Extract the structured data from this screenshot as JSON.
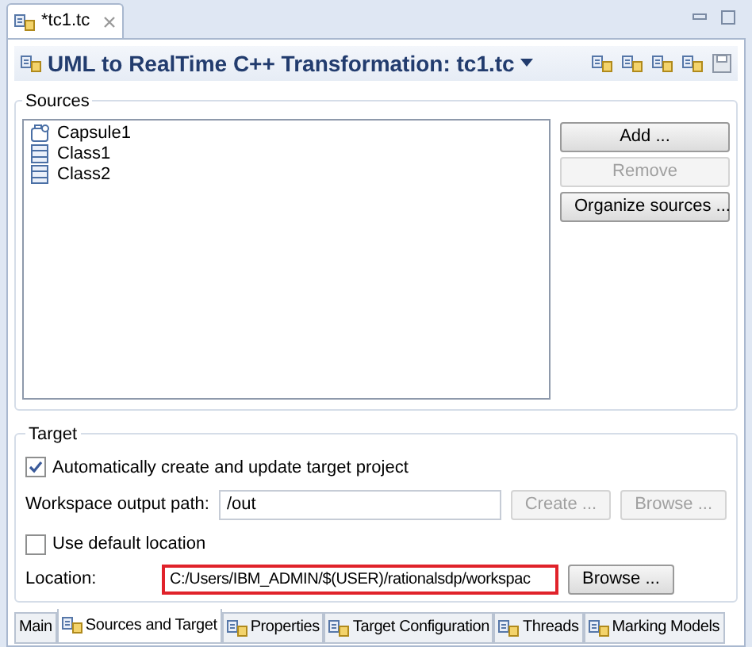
{
  "editor_tab": {
    "title": "*tc1.tc"
  },
  "header": {
    "title": "UML to RealTime C++ Transformation: tc1.tc"
  },
  "sources": {
    "label": "Sources",
    "items": [
      {
        "label": "Capsule1",
        "kind": "capsule"
      },
      {
        "label": "Class1",
        "kind": "class"
      },
      {
        "label": "Class2",
        "kind": "class"
      }
    ],
    "buttons": [
      {
        "label": "Add ...",
        "disabled": false
      },
      {
        "label": "Remove",
        "disabled": true
      },
      {
        "label": "Organize sources ...",
        "disabled": false
      }
    ]
  },
  "target": {
    "label": "Target",
    "auto_create": {
      "label": "Automatically create and update target project",
      "checked": true
    },
    "output_path": {
      "label": "Workspace output path:",
      "value": "/out",
      "buttons": [
        {
          "label": "Create ...",
          "disabled": true
        },
        {
          "label": "Browse ...",
          "disabled": true
        }
      ]
    },
    "default_location": {
      "label": "Use default location",
      "checked": false
    },
    "location": {
      "label": "Location:",
      "value": "C:/Users/IBM_ADMIN/$(USER)/rationalsdp/workspac",
      "highlighted": true,
      "button": {
        "label": "Browse ...",
        "disabled": false
      }
    }
  },
  "tabs": [
    {
      "label": "Main",
      "selected": false,
      "icon": false
    },
    {
      "label": "Sources and Target",
      "selected": true,
      "icon": true
    },
    {
      "label": "Properties",
      "selected": false,
      "icon": true
    },
    {
      "label": "Target Configuration",
      "selected": false,
      "icon": true
    },
    {
      "label": "Threads",
      "selected": false,
      "icon": true
    },
    {
      "label": "Marking Models",
      "selected": false,
      "icon": true
    }
  ]
}
